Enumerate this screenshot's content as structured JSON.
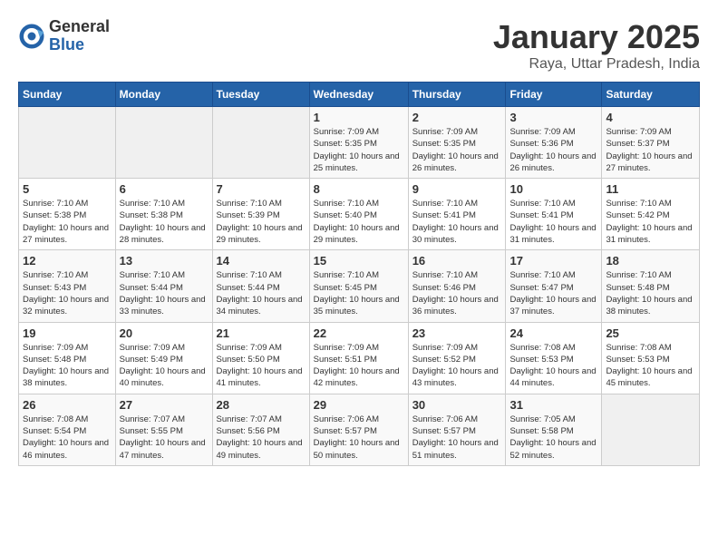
{
  "logo": {
    "general": "General",
    "blue": "Blue"
  },
  "header": {
    "month": "January 2025",
    "location": "Raya, Uttar Pradesh, India"
  },
  "weekdays": [
    "Sunday",
    "Monday",
    "Tuesday",
    "Wednesday",
    "Thursday",
    "Friday",
    "Saturday"
  ],
  "weeks": [
    [
      {
        "day": null
      },
      {
        "day": null
      },
      {
        "day": null
      },
      {
        "day": "1",
        "sunrise": "7:09 AM",
        "sunset": "5:35 PM",
        "daylight": "10 hours and 25 minutes."
      },
      {
        "day": "2",
        "sunrise": "7:09 AM",
        "sunset": "5:35 PM",
        "daylight": "10 hours and 26 minutes."
      },
      {
        "day": "3",
        "sunrise": "7:09 AM",
        "sunset": "5:36 PM",
        "daylight": "10 hours and 26 minutes."
      },
      {
        "day": "4",
        "sunrise": "7:09 AM",
        "sunset": "5:37 PM",
        "daylight": "10 hours and 27 minutes."
      }
    ],
    [
      {
        "day": "5",
        "sunrise": "7:10 AM",
        "sunset": "5:38 PM",
        "daylight": "10 hours and 27 minutes."
      },
      {
        "day": "6",
        "sunrise": "7:10 AM",
        "sunset": "5:38 PM",
        "daylight": "10 hours and 28 minutes."
      },
      {
        "day": "7",
        "sunrise": "7:10 AM",
        "sunset": "5:39 PM",
        "daylight": "10 hours and 29 minutes."
      },
      {
        "day": "8",
        "sunrise": "7:10 AM",
        "sunset": "5:40 PM",
        "daylight": "10 hours and 29 minutes."
      },
      {
        "day": "9",
        "sunrise": "7:10 AM",
        "sunset": "5:41 PM",
        "daylight": "10 hours and 30 minutes."
      },
      {
        "day": "10",
        "sunrise": "7:10 AM",
        "sunset": "5:41 PM",
        "daylight": "10 hours and 31 minutes."
      },
      {
        "day": "11",
        "sunrise": "7:10 AM",
        "sunset": "5:42 PM",
        "daylight": "10 hours and 31 minutes."
      }
    ],
    [
      {
        "day": "12",
        "sunrise": "7:10 AM",
        "sunset": "5:43 PM",
        "daylight": "10 hours and 32 minutes."
      },
      {
        "day": "13",
        "sunrise": "7:10 AM",
        "sunset": "5:44 PM",
        "daylight": "10 hours and 33 minutes."
      },
      {
        "day": "14",
        "sunrise": "7:10 AM",
        "sunset": "5:44 PM",
        "daylight": "10 hours and 34 minutes."
      },
      {
        "day": "15",
        "sunrise": "7:10 AM",
        "sunset": "5:45 PM",
        "daylight": "10 hours and 35 minutes."
      },
      {
        "day": "16",
        "sunrise": "7:10 AM",
        "sunset": "5:46 PM",
        "daylight": "10 hours and 36 minutes."
      },
      {
        "day": "17",
        "sunrise": "7:10 AM",
        "sunset": "5:47 PM",
        "daylight": "10 hours and 37 minutes."
      },
      {
        "day": "18",
        "sunrise": "7:10 AM",
        "sunset": "5:48 PM",
        "daylight": "10 hours and 38 minutes."
      }
    ],
    [
      {
        "day": "19",
        "sunrise": "7:09 AM",
        "sunset": "5:48 PM",
        "daylight": "10 hours and 38 minutes."
      },
      {
        "day": "20",
        "sunrise": "7:09 AM",
        "sunset": "5:49 PM",
        "daylight": "10 hours and 40 minutes."
      },
      {
        "day": "21",
        "sunrise": "7:09 AM",
        "sunset": "5:50 PM",
        "daylight": "10 hours and 41 minutes."
      },
      {
        "day": "22",
        "sunrise": "7:09 AM",
        "sunset": "5:51 PM",
        "daylight": "10 hours and 42 minutes."
      },
      {
        "day": "23",
        "sunrise": "7:09 AM",
        "sunset": "5:52 PM",
        "daylight": "10 hours and 43 minutes."
      },
      {
        "day": "24",
        "sunrise": "7:08 AM",
        "sunset": "5:53 PM",
        "daylight": "10 hours and 44 minutes."
      },
      {
        "day": "25",
        "sunrise": "7:08 AM",
        "sunset": "5:53 PM",
        "daylight": "10 hours and 45 minutes."
      }
    ],
    [
      {
        "day": "26",
        "sunrise": "7:08 AM",
        "sunset": "5:54 PM",
        "daylight": "10 hours and 46 minutes."
      },
      {
        "day": "27",
        "sunrise": "7:07 AM",
        "sunset": "5:55 PM",
        "daylight": "10 hours and 47 minutes."
      },
      {
        "day": "28",
        "sunrise": "7:07 AM",
        "sunset": "5:56 PM",
        "daylight": "10 hours and 49 minutes."
      },
      {
        "day": "29",
        "sunrise": "7:06 AM",
        "sunset": "5:57 PM",
        "daylight": "10 hours and 50 minutes."
      },
      {
        "day": "30",
        "sunrise": "7:06 AM",
        "sunset": "5:57 PM",
        "daylight": "10 hours and 51 minutes."
      },
      {
        "day": "31",
        "sunrise": "7:05 AM",
        "sunset": "5:58 PM",
        "daylight": "10 hours and 52 minutes."
      },
      {
        "day": null
      }
    ]
  ]
}
